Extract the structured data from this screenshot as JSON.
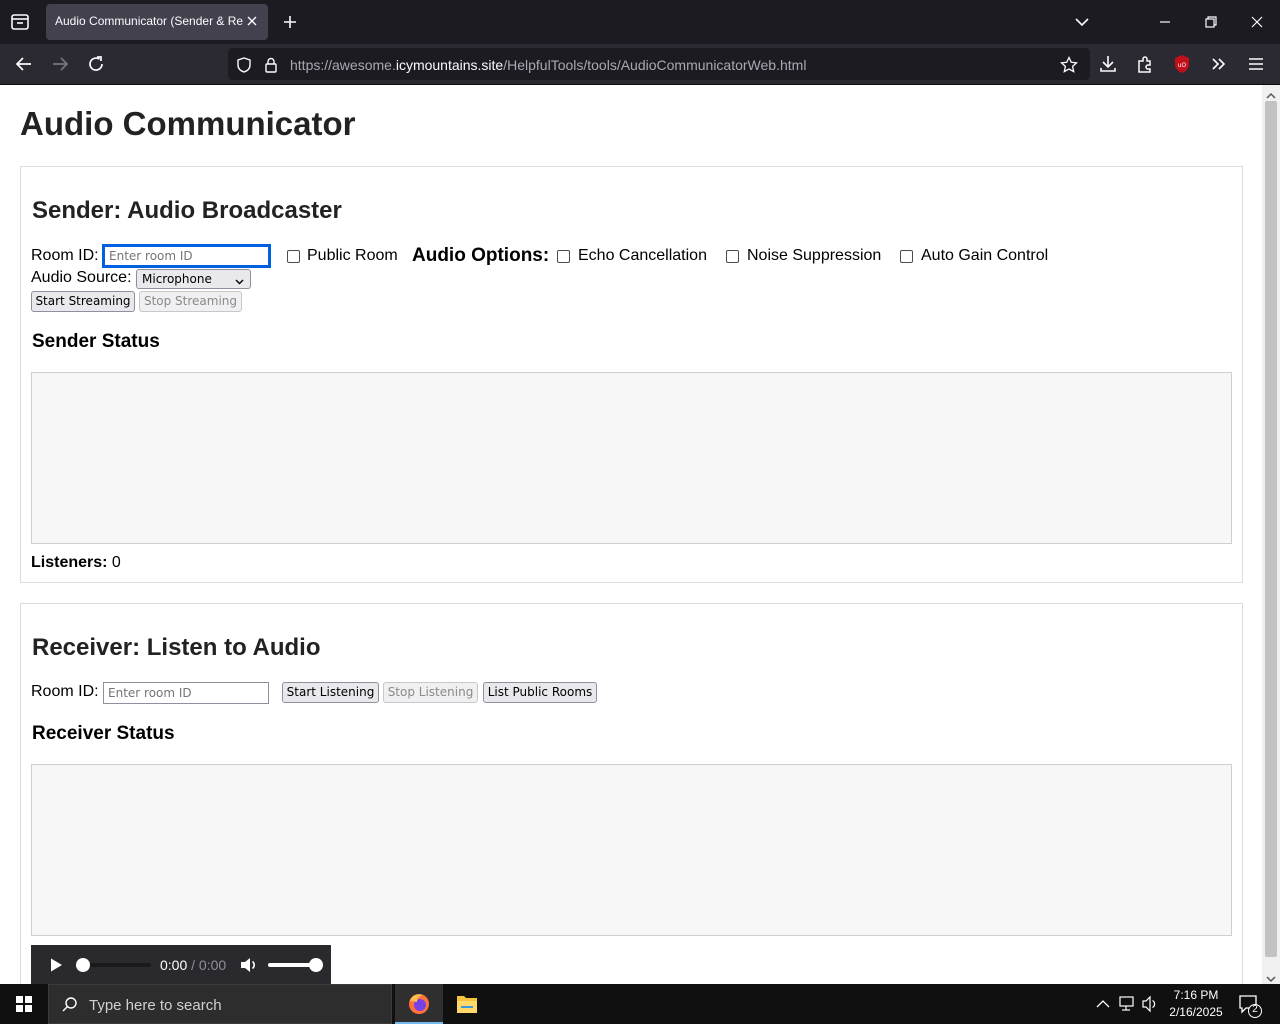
{
  "browser": {
    "tab_title": "Audio Communicator (Sender & Re",
    "url_prefix": "https://awesome.",
    "url_domain": "icymountains.site",
    "url_path": "/HelpfulTools/tools/AudioCommunicatorWeb.html"
  },
  "page": {
    "title": "Audio Communicator",
    "sender": {
      "heading": "Sender: Audio Broadcaster",
      "room_label": "Room ID:",
      "room_placeholder": "Enter room ID",
      "public_room_label": "Public Room",
      "public_room_checked": false,
      "audio_options_label": "Audio Options:",
      "echo_label": "Echo Cancellation",
      "echo_checked": false,
      "noise_label": "Noise Suppression",
      "noise_checked": false,
      "gain_label": "Auto Gain Control",
      "gain_checked": false,
      "source_label": "Audio Source:",
      "source_value": "Microphone",
      "start_button": "Start Streaming",
      "stop_button": "Stop Streaming",
      "status_heading": "Sender Status",
      "listeners_label": "Listeners:",
      "listeners_count": "0"
    },
    "receiver": {
      "heading": "Receiver: Listen to Audio",
      "room_label": "Room ID:",
      "room_placeholder": "Enter room ID",
      "start_button": "Start Listening",
      "stop_button": "Stop Listening",
      "list_button": "List Public Rooms",
      "status_heading": "Receiver Status"
    },
    "audio_player": {
      "current_time": "0:00",
      "separator": "/",
      "duration": "0:00",
      "progress": 0,
      "volume": 1
    }
  },
  "taskbar": {
    "search_placeholder": "Type here to search",
    "time": "7:16 PM",
    "date": "2/16/2025",
    "notification_count": "2"
  },
  "colors": {
    "accent": "#0060df",
    "chrome_dark": "#1c1b22",
    "toolbar": "#2b2a33",
    "ublock_red": "#c1101b",
    "firefox_orange": "#ff7139"
  }
}
